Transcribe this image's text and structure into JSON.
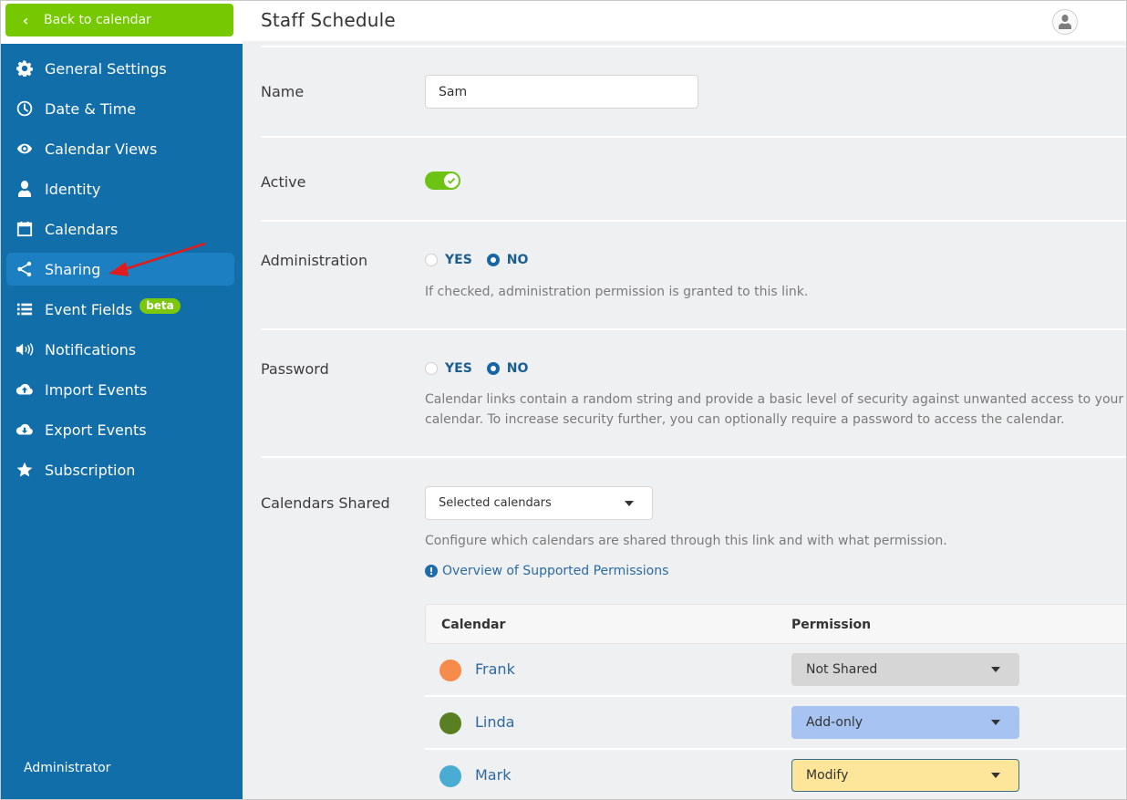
{
  "sidebar": {
    "back_label": "Back to calendar",
    "items": [
      {
        "label": "General Settings",
        "icon": "gear-icon"
      },
      {
        "label": "Date & Time",
        "icon": "clock-icon"
      },
      {
        "label": "Calendar Views",
        "icon": "eye-icon"
      },
      {
        "label": "Identity",
        "icon": "user-icon"
      },
      {
        "label": "Calendars",
        "icon": "calendar-icon"
      },
      {
        "label": "Sharing",
        "icon": "share-icon",
        "active": true
      },
      {
        "label": "Event Fields",
        "icon": "list-icon",
        "badge": "beta"
      },
      {
        "label": "Notifications",
        "icon": "speaker-icon"
      },
      {
        "label": "Import Events",
        "icon": "cloud-upload-icon"
      },
      {
        "label": "Export Events",
        "icon": "cloud-download-icon"
      },
      {
        "label": "Subscription",
        "icon": "star-icon"
      }
    ],
    "footer_label": "Administrator"
  },
  "header": {
    "title": "Staff Schedule",
    "avatar_icon": "user-avatar-icon"
  },
  "form": {
    "name": {
      "label": "Name",
      "value": "Sam"
    },
    "active": {
      "label": "Active",
      "on": true
    },
    "administration": {
      "label": "Administration",
      "options": [
        "YES",
        "NO"
      ],
      "selected": "NO",
      "help": "If checked, administration permission is granted to this link."
    },
    "password": {
      "label": "Password",
      "options": [
        "YES",
        "NO"
      ],
      "selected": "NO",
      "help": "Calendar links contain a random string and provide a basic level of security against unwanted access to your calendar. To increase security further, you can optionally require a password to access the calendar."
    },
    "calendars_shared": {
      "label": "Calendars Shared",
      "selected": "Selected calendars",
      "help": "Configure which calendars are shared through this link and with what permission.",
      "link": "Overview of Supported Permissions"
    }
  },
  "table": {
    "headers": [
      "Calendar",
      "Permission"
    ],
    "rows": [
      {
        "name": "Frank",
        "color": "#f68b4c",
        "permission": "Not Shared",
        "perm_bg": "#d6d6d6"
      },
      {
        "name": "Linda",
        "color": "#5a7f22",
        "permission": "Add-only",
        "perm_bg": "#a6c3f1"
      },
      {
        "name": "Mark",
        "color": "#4aabd3",
        "permission": "Modify",
        "perm_bg": "#fde59a"
      }
    ]
  },
  "colors": {
    "sidebar_bg": "#116ea9",
    "sidebar_active": "#1c7fc2",
    "back_button": "#76c800",
    "toggle_on": "#6cc314",
    "link": "#2c6aa0",
    "annotation_arrow": "#e11b1b"
  }
}
